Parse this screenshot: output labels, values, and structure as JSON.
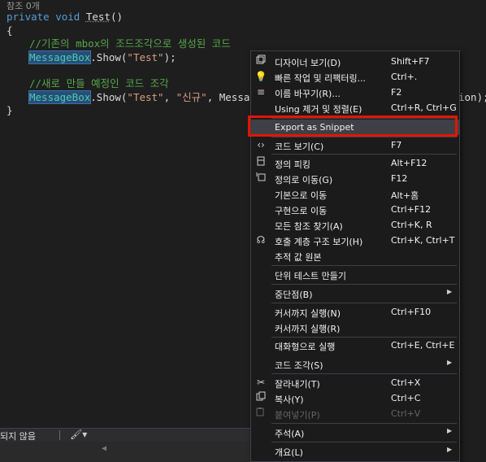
{
  "editor": {
    "codelens": "참조 0개",
    "lines": {
      "l1_kw": "private void ",
      "l1_name": "Test",
      "l1_rest": "()",
      "l2": "{",
      "l3_comment": "//기존의 mbox의 조드조각으로 생성된 코드",
      "l4_cls": "MessageBox",
      "l4_rest": ".Show(",
      "l4_str": "\"Test\"",
      "l4_end": ");",
      "l6_comment": "//새로 만들 예정인 코드 조각",
      "l7_cls": "MessageBox",
      "l7_rest1": ".Show(",
      "l7_str1": "\"Test\"",
      "l7_comma": ", ",
      "l7_str2": "\"신규\"",
      "l7_rest2": ", MessageB",
      "l7_tail": "ion);",
      "l8": "}"
    }
  },
  "statusbar": {
    "issues_text": "되지 않음",
    "brush_icon": "brush-icon"
  },
  "context_menu": {
    "items": [
      {
        "label": "디자이너 보기(D)",
        "shortcut": "Shift+F7",
        "icon": "designer-icon"
      },
      {
        "label": "빠른 작업 및 리팩터링...",
        "shortcut": "Ctrl+.",
        "icon": "lightbulb-icon"
      },
      {
        "label": "이름 바꾸기(R)...",
        "shortcut": "F2",
        "icon": "rename-icon"
      },
      {
        "label": "Using 제거 및 정렬(E)",
        "shortcut": "Ctrl+R, Ctrl+G",
        "icon": ""
      },
      {
        "label": "Export as Snippet",
        "shortcut": "",
        "icon": ""
      },
      {
        "label": "코드 보기(C)",
        "shortcut": "F7",
        "icon": "code-icon"
      },
      {
        "label": "정의 피킹",
        "shortcut": "Alt+F12",
        "icon": "peek-definition-icon"
      },
      {
        "label": "정의로 이동(G)",
        "shortcut": "F12",
        "icon": "go-to-definition-icon"
      },
      {
        "label": "기본으로 이동",
        "shortcut": "Alt+홈",
        "icon": ""
      },
      {
        "label": "구현으로 이동",
        "shortcut": "Ctrl+F12",
        "icon": ""
      },
      {
        "label": "모든 참조 찾기(A)",
        "shortcut": "Ctrl+K, R",
        "icon": ""
      },
      {
        "label": "호출 계층 구조 보기(H)",
        "shortcut": "Ctrl+K, Ctrl+T",
        "icon": "call-hierarchy-icon"
      },
      {
        "label": "추적 값 원본",
        "shortcut": "",
        "icon": ""
      },
      {
        "label": "단위 테스트 만들기",
        "shortcut": "",
        "icon": ""
      },
      {
        "label": "중단점(B)",
        "shortcut": "",
        "icon": ""
      },
      {
        "label": "커서까지 실행(N)",
        "shortcut": "Ctrl+F10",
        "icon": ""
      },
      {
        "label": "커서까지 실행(R)",
        "shortcut": "",
        "icon": ""
      },
      {
        "label": "대화형으로 실행",
        "shortcut": "Ctrl+E, Ctrl+E",
        "icon": ""
      },
      {
        "label": "코드 조각(S)",
        "shortcut": "",
        "icon": ""
      },
      {
        "label": "잘라내기(T)",
        "shortcut": "Ctrl+X",
        "icon": "scissors-icon"
      },
      {
        "label": "복사(Y)",
        "shortcut": "Ctrl+C",
        "icon": "copy-icon"
      },
      {
        "label": "붙여넣기(P)",
        "shortcut": "Ctrl+V",
        "icon": "paste-icon"
      },
      {
        "label": "주석(A)",
        "shortcut": "",
        "icon": ""
      },
      {
        "label": "개요(L)",
        "shortcut": "",
        "icon": ""
      }
    ]
  }
}
